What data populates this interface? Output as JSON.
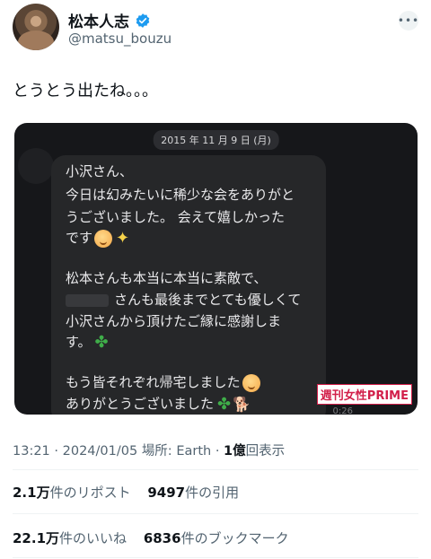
{
  "user": {
    "display_name": "松本人志",
    "handle": "@matsu_bouzu",
    "verified_color": "#1d9bf0"
  },
  "tweet": {
    "text": "とうとう出たね。。。"
  },
  "media": {
    "date_label": "2015 年 11 月 9 日 (月)",
    "lines": [
      "小沢さん、",
      "今日は幻みたいに稀少な会をありがと",
      "うございました。 会えて嬉しかった",
      "です",
      "松本さんも本当に本当に素敵で、",
      "さんも最後までとても優しくて",
      "小沢さんから頂けたご縁に感謝しま",
      "す。",
      "もう皆それぞれ帰宅しました",
      "ありがとうございました"
    ],
    "watermark": "週刊女性PRIME",
    "duration": "0:26"
  },
  "meta": {
    "time": "13:21",
    "sep1": "·",
    "date": "2024/01/05",
    "location_label": "場所:",
    "location": "Earth",
    "sep2": "·",
    "views_num": "1億",
    "views_label": "回表示"
  },
  "stats": {
    "reposts_num": "2.1万",
    "reposts_label": "件のリポスト",
    "quotes_num": "9497",
    "quotes_label": "件の引用",
    "likes_num": "22.1万",
    "likes_label": "件のいいね",
    "bookmarks_num": "6836",
    "bookmarks_label": "件のブックマーク"
  }
}
